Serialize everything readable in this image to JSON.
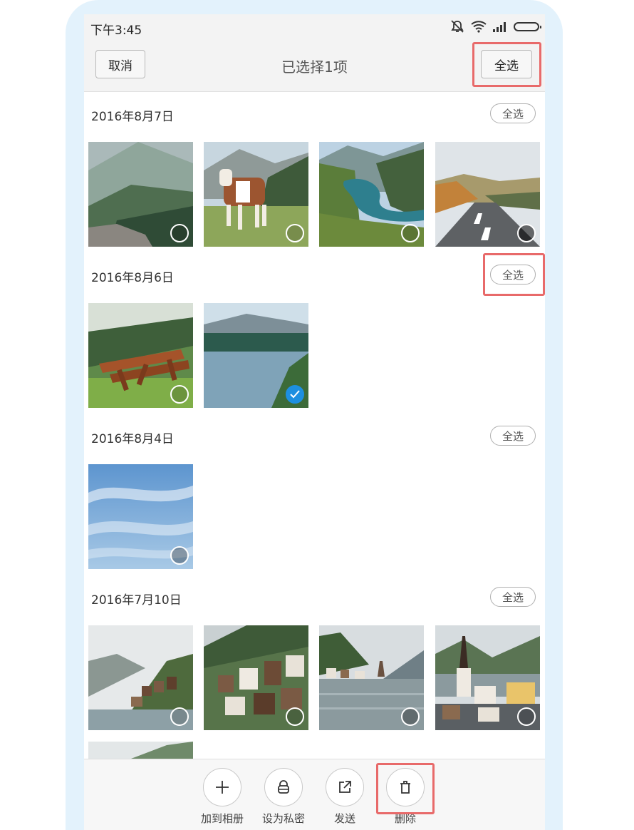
{
  "status_bar": {
    "time": "下午3:45",
    "icons": [
      "mute-icon",
      "wifi-icon",
      "signal-icon",
      "battery-icon"
    ]
  },
  "header": {
    "cancel_label": "取消",
    "title": "已选择1项",
    "select_all_label": "全选"
  },
  "groups": [
    {
      "date": "2016年8月7日",
      "select_all": "全选",
      "photos": [
        {
          "subject": "mountain-slope",
          "selected": false
        },
        {
          "subject": "cow",
          "selected": false
        },
        {
          "subject": "mountain-lake",
          "selected": false
        },
        {
          "subject": "mountain-road",
          "selected": false
        }
      ]
    },
    {
      "date": "2016年8月6日",
      "select_all": "全选",
      "photos": [
        {
          "subject": "wooden-bench",
          "selected": false
        },
        {
          "subject": "lake-shore",
          "selected": true
        }
      ]
    },
    {
      "date": "2016年8月4日",
      "select_all": "全选",
      "photos": [
        {
          "subject": "sky",
          "selected": false
        }
      ]
    },
    {
      "date": "2016年7月10日",
      "select_all": "全选",
      "photos": [
        {
          "subject": "hallstatt-village",
          "selected": false
        },
        {
          "subject": "hallstatt-houses",
          "selected": false
        },
        {
          "subject": "hallstatt-lake",
          "selected": false
        },
        {
          "subject": "hallstatt-church",
          "selected": false
        }
      ]
    }
  ],
  "actions": [
    {
      "label": "加到相册",
      "icon": "plus-icon"
    },
    {
      "label": "设为私密",
      "icon": "lock-icon"
    },
    {
      "label": "发送",
      "icon": "share-icon"
    },
    {
      "label": "删除",
      "icon": "trash-icon"
    }
  ],
  "colors": {
    "accent": "#1d8fe0",
    "highlight": "#e86a6a",
    "frame": "#e3f2fc"
  }
}
